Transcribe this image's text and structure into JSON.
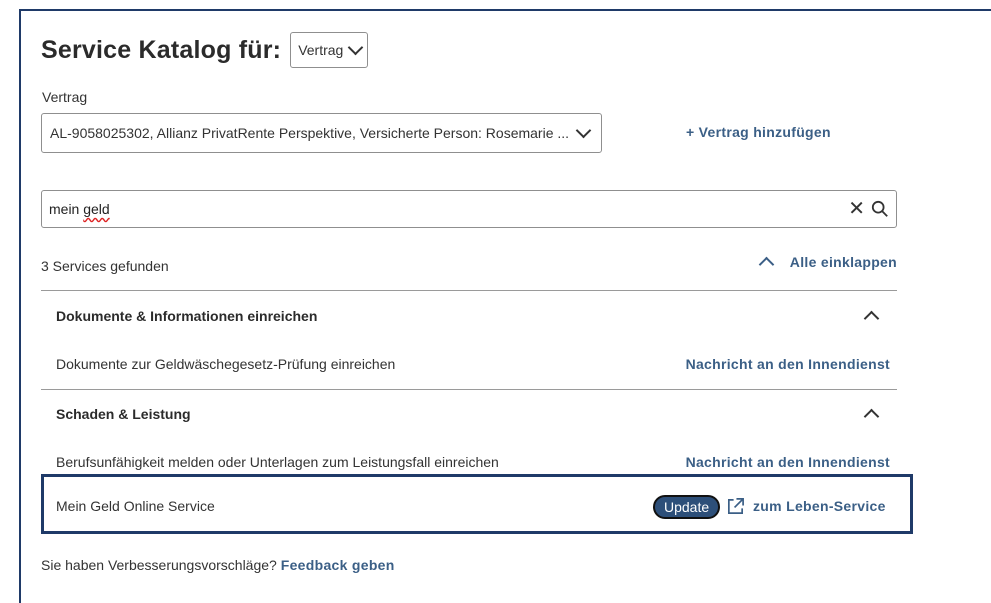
{
  "header": {
    "title": "Service Katalog für:",
    "selector_value": "Vertrag"
  },
  "contract": {
    "label": "Vertrag",
    "selected": "AL-9058025302, Allianz PrivatRente Perspektive, Versicherte Person: Rosemarie ...",
    "add_label": "+ Vertrag hinzufügen"
  },
  "search": {
    "value_prefix": "mein ",
    "value_misspelled": "geld"
  },
  "results": {
    "count_text": "3 Services gefunden",
    "collapse_all_label": "Alle einklappen"
  },
  "sections": [
    {
      "title": "Dokumente & Informationen einreichen",
      "items": [
        {
          "label": "Dokumente zur Geldwäschegesetz-Prüfung einreichen",
          "action": "Nachricht an den Innendienst"
        }
      ]
    },
    {
      "title": "Schaden & Leistung",
      "items": [
        {
          "label": "Berufsunfähigkeit melden oder Unterlagen zum Leistungsfall einreichen",
          "action": "Nachricht an den Innendienst"
        },
        {
          "label": "Mein Geld Online Service",
          "badge": "Update",
          "action": "zum Leben-Service"
        }
      ]
    }
  ],
  "feedback": {
    "text": "Sie haben Verbesserungsvorschläge?",
    "link": "Feedback geben"
  },
  "colors": {
    "accent": "#3b5f86",
    "highlight_border": "#1f3a68",
    "badge_bg": "#2d4f79"
  },
  "icons": [
    "chevron-down-icon",
    "chevron-up-icon",
    "close-icon",
    "search-icon",
    "external-link-icon"
  ]
}
